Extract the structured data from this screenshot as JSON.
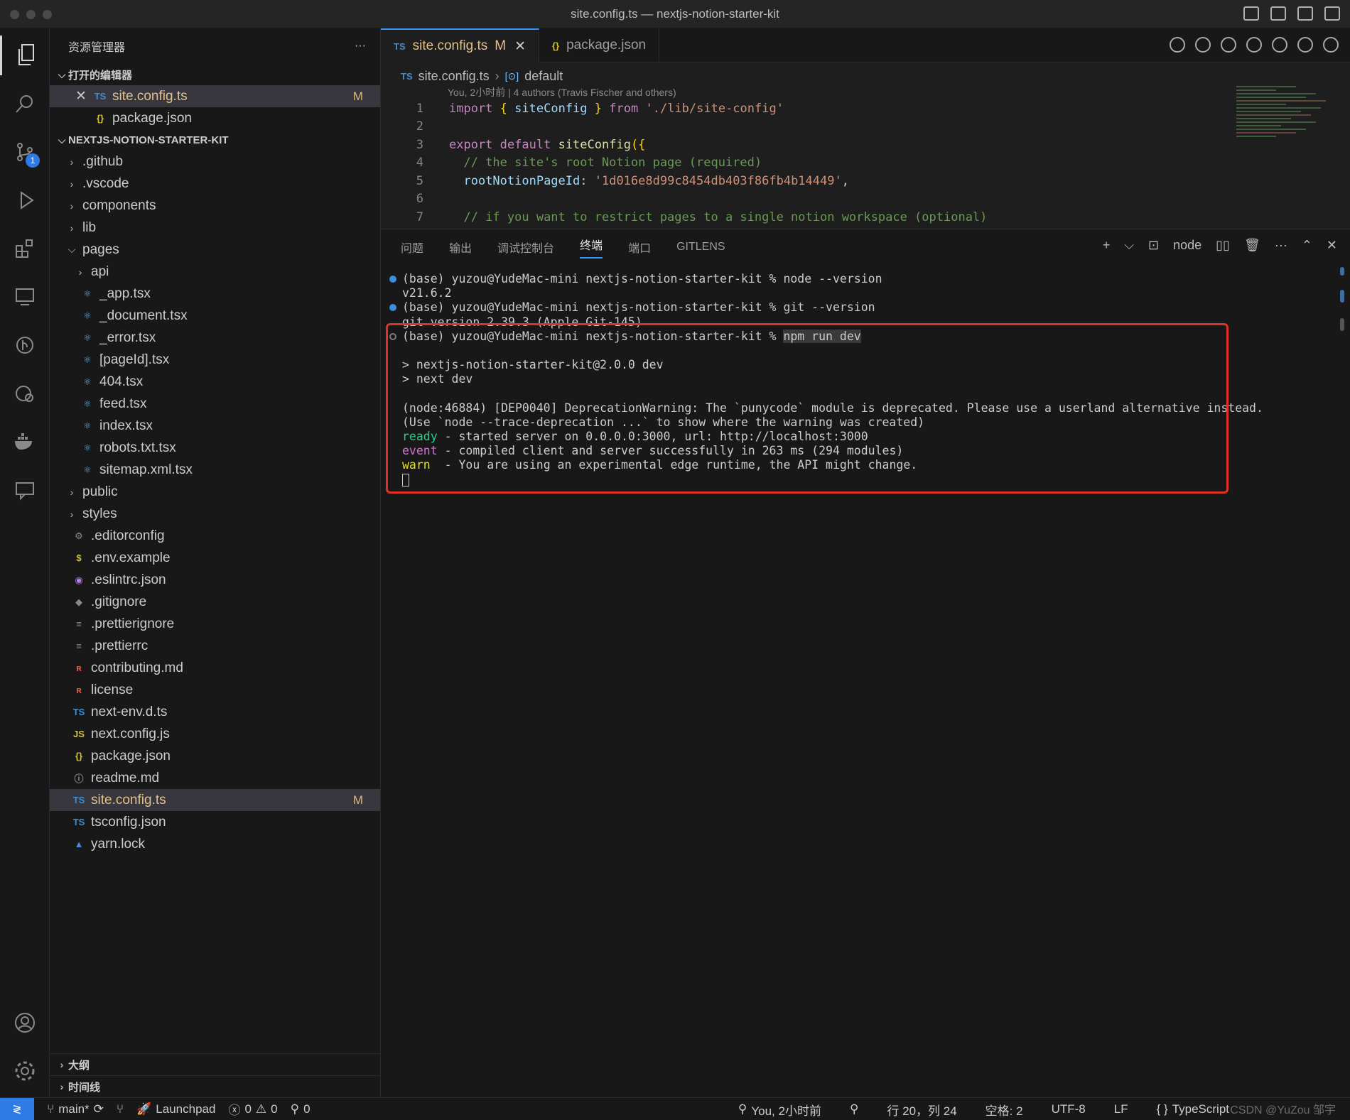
{
  "window": {
    "title": "site.config.ts — nextjs-notion-starter-kit"
  },
  "activity_bar": {
    "scm_badge": "1"
  },
  "sidebar": {
    "title": "资源管理器",
    "more": "···",
    "open_editors_label": "打开的编辑器",
    "open_editors": [
      {
        "icon": "TS",
        "name": "site.config.ts",
        "status": "M",
        "close": "✕"
      },
      {
        "icon": "{}",
        "name": "package.json"
      }
    ],
    "project_label": "NEXTJS-NOTION-STARTER-KIT",
    "tree": [
      {
        "type": "folder",
        "name": ".github"
      },
      {
        "type": "folder",
        "name": ".vscode"
      },
      {
        "type": "folder",
        "name": "components"
      },
      {
        "type": "folder",
        "name": "lib"
      },
      {
        "type": "folder-open",
        "name": "pages"
      },
      {
        "type": "folder",
        "name": "api"
      },
      {
        "type": "file",
        "icon": "⚛",
        "name": "_app.tsx"
      },
      {
        "type": "file",
        "icon": "⚛",
        "name": "_document.tsx"
      },
      {
        "type": "file",
        "icon": "⚛",
        "name": "_error.tsx"
      },
      {
        "type": "file",
        "icon": "⚛",
        "name": "[pageId].tsx"
      },
      {
        "type": "file",
        "icon": "⚛",
        "name": "404.tsx"
      },
      {
        "type": "file",
        "icon": "⚛",
        "name": "feed.tsx"
      },
      {
        "type": "file",
        "icon": "⚛",
        "name": "index.tsx"
      },
      {
        "type": "file",
        "icon": "⚛",
        "name": "robots.txt.tsx"
      },
      {
        "type": "file",
        "icon": "⚛",
        "name": "sitemap.xml.tsx"
      },
      {
        "type": "folder",
        "name": "public"
      },
      {
        "type": "folder",
        "name": "styles"
      },
      {
        "type": "file",
        "icon": "⚙",
        "name": ".editorconfig"
      },
      {
        "type": "file",
        "icon": "$",
        "name": ".env.example"
      },
      {
        "type": "file",
        "icon": "◉",
        "name": ".eslintrc.json"
      },
      {
        "type": "file",
        "icon": "◆",
        "name": ".gitignore"
      },
      {
        "type": "file",
        "icon": "≡",
        "name": ".prettierignore"
      },
      {
        "type": "file",
        "icon": "≡",
        "name": ".prettierrc"
      },
      {
        "type": "file",
        "icon": "ʀ",
        "name": "contributing.md"
      },
      {
        "type": "file",
        "icon": "ʀ",
        "name": "license"
      },
      {
        "type": "file",
        "icon": "TS",
        "name": "next-env.d.ts"
      },
      {
        "type": "file",
        "icon": "JS",
        "name": "next.config.js"
      },
      {
        "type": "file",
        "icon": "{}",
        "name": "package.json"
      },
      {
        "type": "file",
        "icon": "ⓘ",
        "name": "readme.md"
      },
      {
        "type": "file",
        "icon": "TS",
        "name": "site.config.ts",
        "status": "M"
      },
      {
        "type": "file",
        "icon": "TS",
        "name": "tsconfig.json"
      },
      {
        "type": "file",
        "icon": "▲",
        "name": "yarn.lock"
      }
    ],
    "outline_label": "大纲",
    "timeline_label": "时间线"
  },
  "tabs": [
    {
      "icon": "TS",
      "label": "site.config.ts",
      "status": "M",
      "close": "✕",
      "active": true
    },
    {
      "icon": "{}",
      "label": "package.json"
    }
  ],
  "breadcrumb": {
    "file_icon": "TS",
    "file": "site.config.ts",
    "sep": "›",
    "symbol_icon": "[⊙]",
    "symbol": "default"
  },
  "blame": "You, 2小时前 | 4 authors (Travis Fischer and others)",
  "code_lines": [
    "1",
    "2",
    "3",
    "4",
    "5",
    "6",
    "7"
  ],
  "panel": {
    "tabs": [
      "问题",
      "输出",
      "调试控制台",
      "终端",
      "端口",
      "GITLENS"
    ],
    "active_tab": "终端",
    "shell": "node",
    "plus": "+",
    "terminal": {
      "l1_prompt": "(base) yuzou@YudeMac-mini nextjs-notion-starter-kit % ",
      "l1_cmd": "node --version",
      "l2": "v21.6.2",
      "l3_prompt": "(base) yuzou@YudeMac-mini nextjs-notion-starter-kit % ",
      "l3_cmd": "git --version",
      "l4": "git version 2.39.3 (Apple Git-145)",
      "l5_prompt": "(base) yuzou@YudeMac-mini nextjs-notion-starter-kit % ",
      "l5_cmd": "npm run dev",
      "l6": "> nextjs-notion-starter-kit@2.0.0 dev",
      "l7": "> next dev",
      "l8": "(node:46884) [DEP0040] DeprecationWarning: The `punycode` module is deprecated. Please use a userland alternative instead.",
      "l9": "(Use `node --trace-deprecation ...` to show where the warning was created)",
      "ready_tag": "ready",
      "ready_text": " - started server on 0.0.0.0:3000, url: http://localhost:3000",
      "event_tag": "event",
      "event_text": " - compiled client and server successfully in 263 ms (294 modules)",
      "warn_tag": "warn",
      "warn_text": "  - You are using an experimental edge runtime, the API might change."
    }
  },
  "status_bar": {
    "branch": "main*",
    "launchpad": "Launchpad",
    "errors": "0",
    "warnings": "0",
    "ports": "0",
    "blame": "You, 2小时前",
    "position": "行 20，列 24",
    "spaces": "空格: 2",
    "encoding": "UTF-8",
    "eol": "LF",
    "language": "TypeScript"
  },
  "watermark": "CSDN @YuZou 邹宇"
}
